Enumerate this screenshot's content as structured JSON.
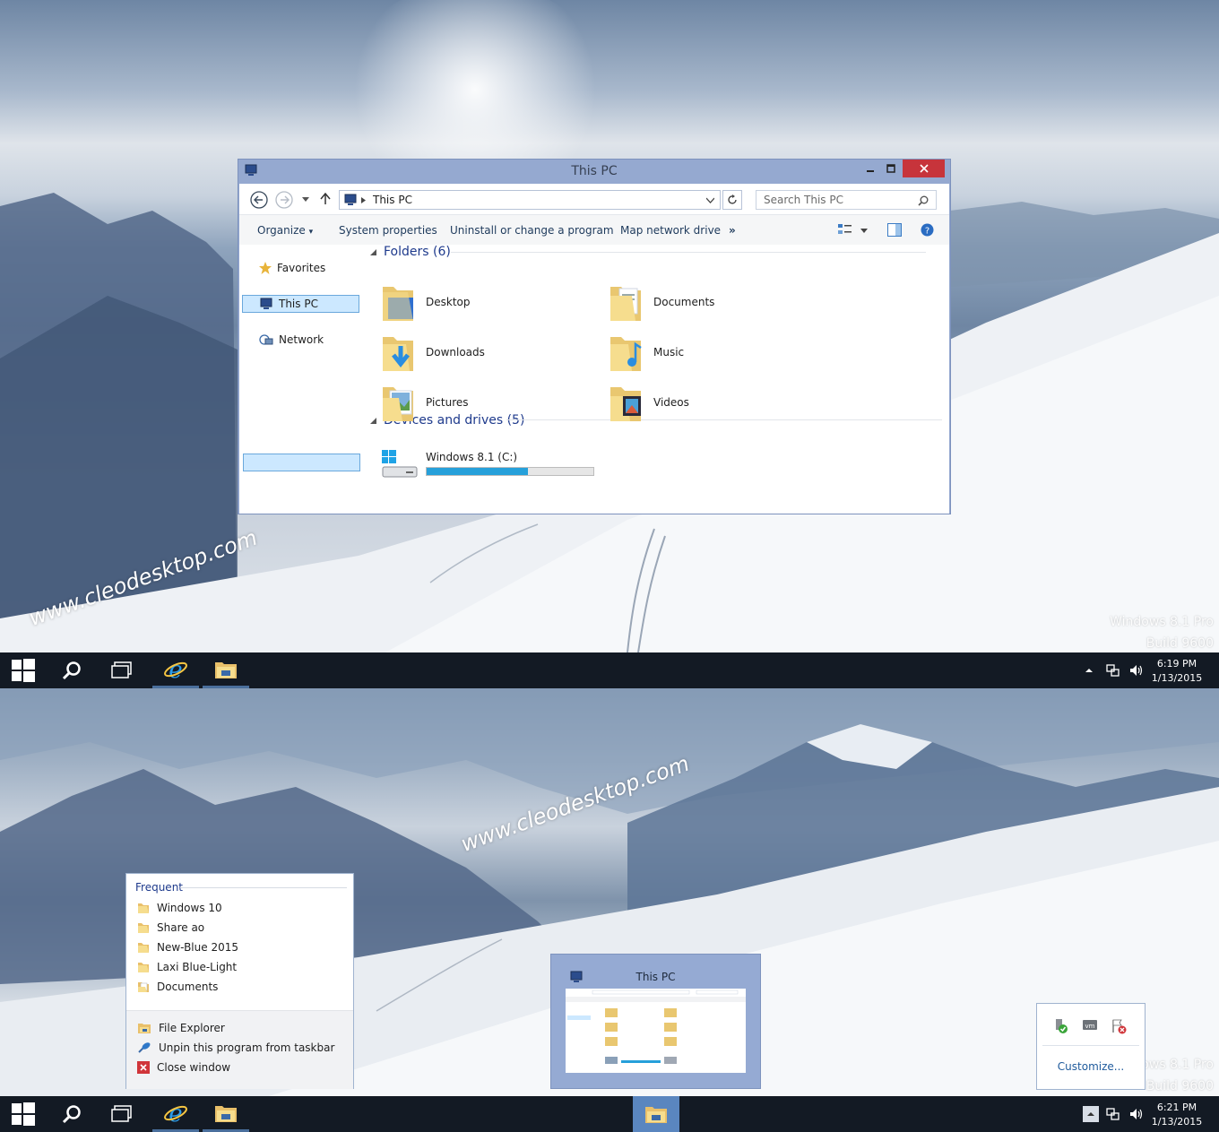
{
  "top_screen": {
    "explorer": {
      "title": "This PC",
      "address": "This PC",
      "search_placeholder": "Search This PC",
      "commands": [
        "Organize",
        "System properties",
        "Uninstall or change a program",
        "Map network drive"
      ],
      "more_glyph": "»",
      "nav": [
        {
          "label": "Favorites",
          "icon": "star-icon"
        },
        {
          "label": "This PC",
          "icon": "computer-icon"
        },
        {
          "label": "Network",
          "icon": "network-icon"
        }
      ],
      "folders_header": "Folders (6)",
      "folders": [
        {
          "label": "Desktop",
          "icon": "desktop-folder-icon"
        },
        {
          "label": "Documents",
          "icon": "documents-folder-icon"
        },
        {
          "label": "Downloads",
          "icon": "downloads-folder-icon"
        },
        {
          "label": "Music",
          "icon": "music-folder-icon"
        },
        {
          "label": "Pictures",
          "icon": "pictures-folder-icon"
        },
        {
          "label": "Videos",
          "icon": "videos-folder-icon"
        }
      ],
      "devices_header": "Devices and drives (5)",
      "drive": {
        "label": "Windows 8.1 (C:)",
        "used_fraction": 0.61,
        "bar_color": "#26a0da"
      }
    },
    "watermark": "www.cleodesktop.com",
    "os_version": [
      "Windows 8.1 Pro",
      "Build 9600"
    ],
    "clock": {
      "time": "6:19 PM",
      "date": "1/13/2015"
    }
  },
  "bottom_screen": {
    "watermark": "www.cleodesktop.com",
    "os_version": [
      "ows 8.1 Pro",
      "Build 9600"
    ],
    "jump_list": {
      "header": "Frequent",
      "items": [
        "Windows 10",
        "Share ao",
        "New-Blue 2015",
        "Laxi Blue-Light",
        "Documents"
      ],
      "tasks": [
        {
          "label": "File Explorer",
          "icon": "file-explorer-icon"
        },
        {
          "label": "Unpin this program from taskbar",
          "icon": "unpin-icon"
        },
        {
          "label": "Close window",
          "icon": "close-window-icon"
        }
      ]
    },
    "thumbnail": {
      "title": "This PC"
    },
    "tray_flyout": {
      "customize": "Customize..."
    },
    "clock": {
      "time": "6:21 PM",
      "date": "1/13/2015"
    }
  },
  "colors": {
    "accent": "#5a86bf",
    "taskbar": "#131a24",
    "window_frame": "#95a9d0",
    "close": "#c7343b"
  }
}
